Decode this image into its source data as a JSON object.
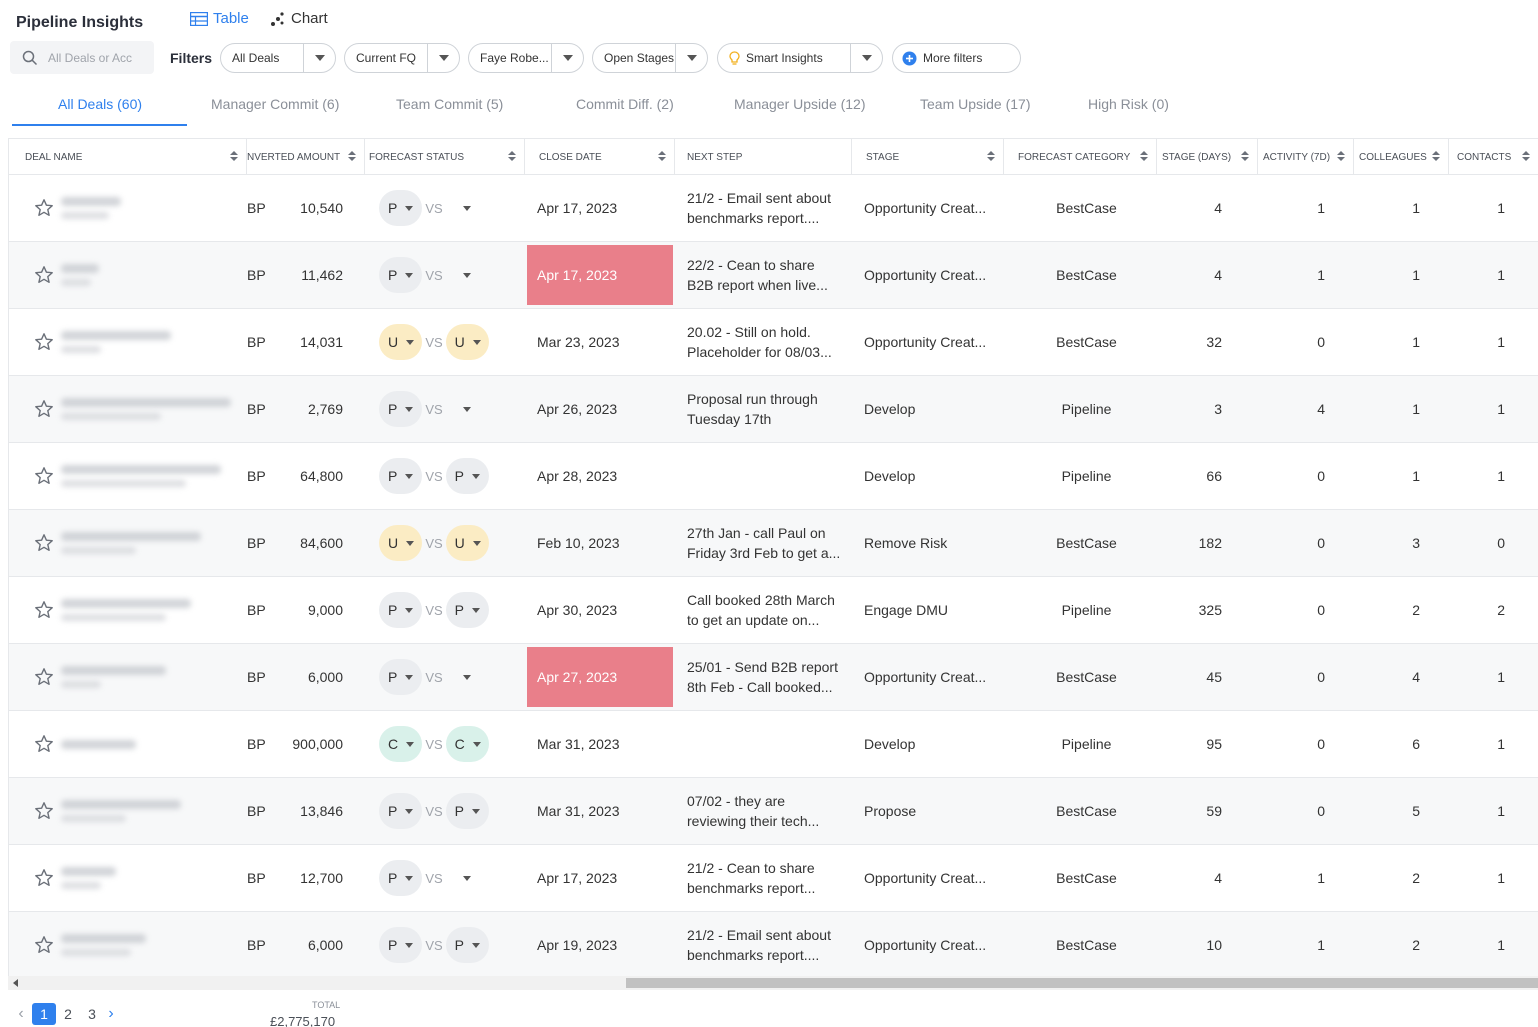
{
  "app": {
    "title": "Pipeline Insights"
  },
  "views": {
    "table_label": "Table",
    "chart_label": "Chart",
    "active": "table"
  },
  "search": {
    "placeholder": "All Deals or Acc"
  },
  "filters": {
    "label": "Filters",
    "items": [
      {
        "text": "All Deals"
      },
      {
        "text": "Current FQ"
      },
      {
        "text": "Faye Robe..."
      },
      {
        "text": "Open Stages"
      },
      {
        "text": "Smart Insights"
      }
    ],
    "more_label": "More filters"
  },
  "tabs": [
    {
      "label": "All Deals (60)",
      "active": true
    },
    {
      "label": "Manager Commit (6)"
    },
    {
      "label": "Team Commit (5)"
    },
    {
      "label": "Commit Diff. (2)"
    },
    {
      "label": "Manager Upside (12)"
    },
    {
      "label": "Team Upside (17)"
    },
    {
      "label": "High Risk (0)"
    }
  ],
  "columns": [
    "Deal Name",
    "nverted Amount",
    "Forecast Status",
    "Close Date",
    "Next Step",
    "Stage",
    "Forecast Category",
    "Stage (Days)",
    "Activity (7D)",
    "Colleagues",
    "Contacts"
  ],
  "rows": [
    {
      "currency": "BP",
      "amount": "10,540",
      "fs_left": "P",
      "fs_right": "",
      "close_date": "Apr 17, 2023",
      "overdue": false,
      "next1": "21/2 - Email sent about",
      "next2": "benchmarks report....",
      "stage": "Opportunity Creat...",
      "category": "BestCase",
      "stage_days": "4",
      "activity": "1",
      "colleagues": "1",
      "contacts": "1"
    },
    {
      "currency": "BP",
      "amount": "11,462",
      "fs_left": "P",
      "fs_right": "",
      "close_date": "Apr 17, 2023",
      "overdue": true,
      "next1": "22/2 - Cean to share",
      "next2": "B2B report when live...",
      "stage": "Opportunity Creat...",
      "category": "BestCase",
      "stage_days": "4",
      "activity": "1",
      "colleagues": "1",
      "contacts": "1"
    },
    {
      "currency": "BP",
      "amount": "14,031",
      "fs_left": "U",
      "fs_right": "U",
      "close_date": "Mar 23, 2023",
      "overdue": false,
      "next1": "20.02 - Still on hold.",
      "next2": "Placeholder for 08/03...",
      "stage": "Opportunity Creat...",
      "category": "BestCase",
      "stage_days": "32",
      "activity": "0",
      "colleagues": "1",
      "contacts": "1"
    },
    {
      "currency": "BP",
      "amount": "2,769",
      "fs_left": "P",
      "fs_right": "",
      "close_date": "Apr 26, 2023",
      "overdue": false,
      "next1": "Proposal run through",
      "next2": "Tuesday 17th",
      "stage": "Develop",
      "category": "Pipeline",
      "stage_days": "3",
      "activity": "4",
      "colleagues": "1",
      "contacts": "1"
    },
    {
      "currency": "BP",
      "amount": "64,800",
      "fs_left": "P",
      "fs_right": "P",
      "close_date": "Apr 28, 2023",
      "overdue": false,
      "next1": "",
      "next2": "",
      "stage": "Develop",
      "category": "Pipeline",
      "stage_days": "66",
      "activity": "0",
      "colleagues": "1",
      "contacts": "1"
    },
    {
      "currency": "BP",
      "amount": "84,600",
      "fs_left": "U",
      "fs_right": "U",
      "close_date": "Feb 10, 2023",
      "overdue": false,
      "next1": "27th Jan - call Paul on",
      "next2": "Friday 3rd Feb to get a...",
      "stage": "Remove Risk",
      "category": "BestCase",
      "stage_days": "182",
      "activity": "0",
      "colleagues": "3",
      "contacts": "0"
    },
    {
      "currency": "BP",
      "amount": "9,000",
      "fs_left": "P",
      "fs_right": "P",
      "close_date": "Apr 30, 2023",
      "overdue": false,
      "next1": "Call booked 28th March",
      "next2": "to get an update on...",
      "stage": "Engage DMU",
      "category": "Pipeline",
      "stage_days": "325",
      "activity": "0",
      "colleagues": "2",
      "contacts": "2"
    },
    {
      "currency": "BP",
      "amount": "6,000",
      "fs_left": "P",
      "fs_right": "",
      "close_date": "Apr 27, 2023",
      "overdue": true,
      "next1": "25/01 - Send B2B report",
      "next2": "8th Feb - Call booked...",
      "stage": "Opportunity Creat...",
      "category": "BestCase",
      "stage_days": "45",
      "activity": "0",
      "colleagues": "4",
      "contacts": "1"
    },
    {
      "currency": "BP",
      "amount": "900,000",
      "fs_left": "C",
      "fs_right": "C",
      "close_date": "Mar 31, 2023",
      "overdue": false,
      "next1": "",
      "next2": "",
      "stage": "Develop",
      "category": "Pipeline",
      "stage_days": "95",
      "activity": "0",
      "colleagues": "6",
      "contacts": "1"
    },
    {
      "currency": "BP",
      "amount": "13,846",
      "fs_left": "P",
      "fs_right": "P",
      "close_date": "Mar 31, 2023",
      "overdue": false,
      "next1": "07/02 - they are",
      "next2": "reviewing their tech...",
      "stage": "Propose",
      "category": "BestCase",
      "stage_days": "59",
      "activity": "0",
      "colleagues": "5",
      "contacts": "1"
    },
    {
      "currency": "BP",
      "amount": "12,700",
      "fs_left": "P",
      "fs_right": "",
      "close_date": "Apr 17, 2023",
      "overdue": false,
      "next1": "21/2 - Cean to share",
      "next2": "benchmarks report...",
      "stage": "Opportunity Creat...",
      "category": "BestCase",
      "stage_days": "4",
      "activity": "1",
      "colleagues": "2",
      "contacts": "1"
    },
    {
      "currency": "BP",
      "amount": "6,000",
      "fs_left": "P",
      "fs_right": "P",
      "close_date": "Apr 19, 2023",
      "overdue": false,
      "next1": "21/2 - Email sent about",
      "next2": "benchmarks report....",
      "stage": "Opportunity Creat...",
      "category": "BestCase",
      "stage_days": "10",
      "activity": "1",
      "colleagues": "2",
      "contacts": "1"
    }
  ],
  "vs_label": "VS",
  "status_colors": {
    "P": "#ebedf0",
    "U": "#fbecc4",
    "C": "#d9f1ea"
  },
  "colors": {
    "accent": "#2f80ed",
    "overdue": "#e97f8a"
  },
  "pagination": {
    "pages": [
      "1",
      "2",
      "3"
    ],
    "current": "1"
  },
  "total": {
    "label": "TOTAL",
    "value": "£2,775,170"
  }
}
